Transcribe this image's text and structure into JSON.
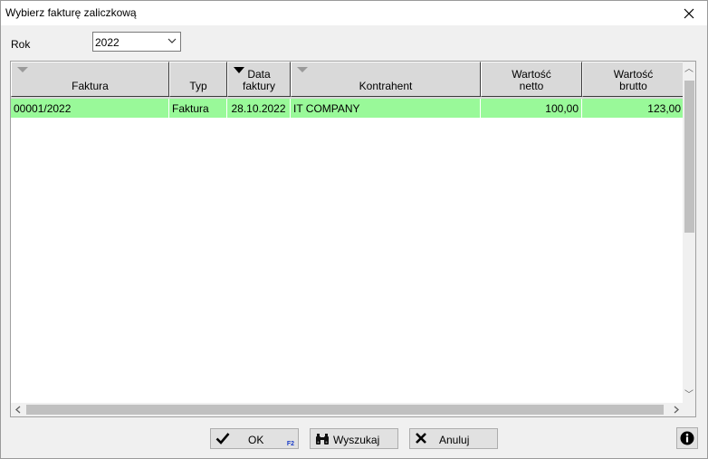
{
  "window": {
    "title": "Wybierz fakturę zaliczkową"
  },
  "filter": {
    "label": "Rok",
    "value": "2022"
  },
  "grid": {
    "columns": [
      {
        "label": "Faktura",
        "sort": "none"
      },
      {
        "label": "Typ",
        "sort": ""
      },
      {
        "label": "Data\nfaktury",
        "sort": "desc"
      },
      {
        "label": "Kontrahent",
        "sort": "none"
      },
      {
        "label": "Wartość\nnetto",
        "sort": ""
      },
      {
        "label": "Wartość\nbrutto",
        "sort": ""
      }
    ],
    "rows": [
      {
        "faktura": "00001/2022",
        "typ": "Faktura",
        "data": "28.10.2022",
        "kontrahent": "IT COMPANY",
        "netto": "100,00",
        "brutto": "123,00"
      }
    ],
    "row_highlight_color": "#99f999"
  },
  "buttons": {
    "ok": {
      "label": "OK",
      "shortcut": "F2",
      "icon": "checkmark-icon"
    },
    "search": {
      "label": "Wyszukaj",
      "icon": "binoculars-icon"
    },
    "cancel": {
      "label": "Anuluj",
      "icon": "x-icon"
    },
    "info": {
      "icon": "info-icon"
    }
  }
}
